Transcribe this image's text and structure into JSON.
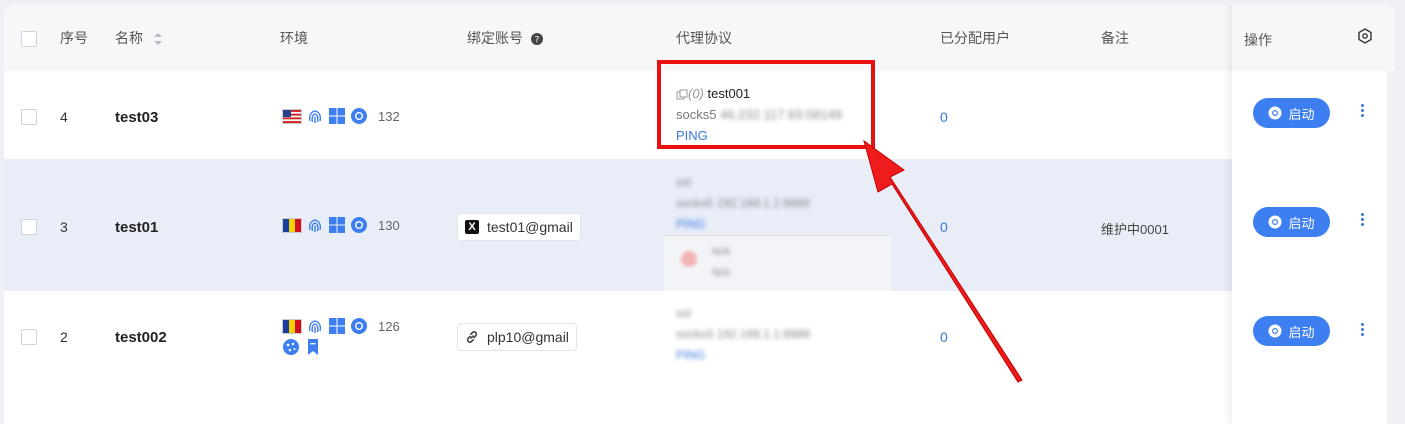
{
  "header": {
    "index": "序号",
    "name": "名称",
    "env": "环境",
    "account": "绑定账号",
    "proxy": "代理协议",
    "assigned": "已分配用户",
    "note": "备注",
    "ops": "操作"
  },
  "rows": [
    {
      "index": "4",
      "name": "test03",
      "flag": "US",
      "count": "132",
      "account": "",
      "proxy_count": "(0)",
      "proxy_name": "test001",
      "proxy_protocol": "socks5",
      "proxy_addr": "46.232.117.93:58149",
      "ping": "PING",
      "assigned": "0",
      "note": "",
      "start": "启动"
    },
    {
      "index": "3",
      "name": "test01",
      "flag": "AD",
      "count": "130",
      "account": "test01@gmail",
      "account_icon": "x-icon",
      "proxy_name": "ssl",
      "proxy_protocol": "socks5",
      "proxy_addr": "192.168.1.1:8888",
      "ping": "PING",
      "popup_line1": "N/A",
      "popup_line2": "N/A",
      "assigned": "0",
      "note": "维护中0001",
      "start": "启动"
    },
    {
      "index": "2",
      "name": "test002",
      "flag": "AD",
      "count": "126",
      "account": "plp10@gmail",
      "account_icon": "link-icon",
      "proxy_name": "ssl",
      "proxy_protocol": "socks5",
      "proxy_addr": "192.168.1.1:8888",
      "ping": "PING",
      "assigned": "0",
      "note": "",
      "start": "启动"
    }
  ],
  "colors": {
    "accent": "#3d7ff0",
    "highlight": "#e81010",
    "row_selected": "#e8edf8"
  }
}
